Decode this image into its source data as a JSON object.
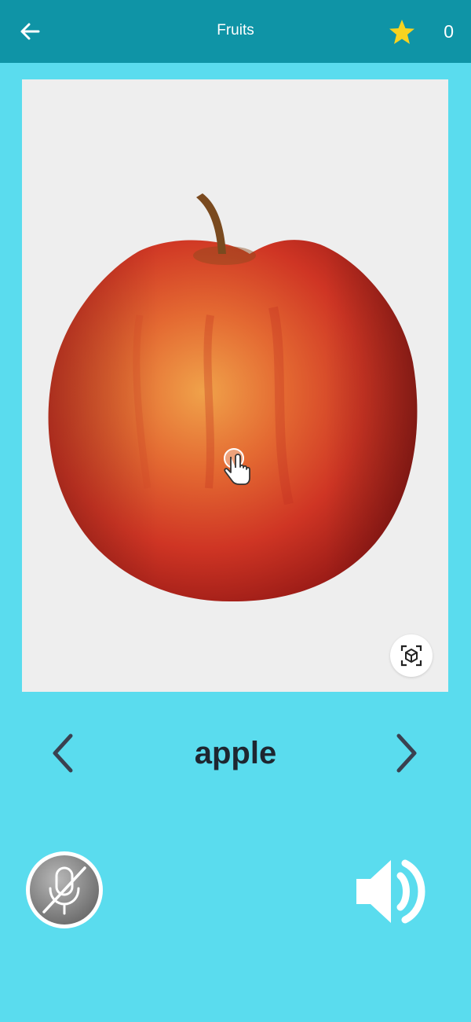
{
  "header": {
    "title": "Fruits",
    "back_icon": "arrow-left-icon",
    "star_icon": "star-icon",
    "star_count": "0"
  },
  "viewer": {
    "subject": "apple",
    "tap_hint_icon": "hand-pointer-icon",
    "ar_icon": "ar-cube-icon"
  },
  "word_nav": {
    "prev_icon": "chevron-left-icon",
    "word": "apple",
    "next_icon": "chevron-right-icon"
  },
  "controls": {
    "mic_icon": "microphone-off-icon",
    "speaker_icon": "speaker-icon"
  },
  "colors": {
    "background": "#5adcee",
    "app_bar": "#0f94a6",
    "star": "#f7d320",
    "word_text": "#1e2630"
  }
}
